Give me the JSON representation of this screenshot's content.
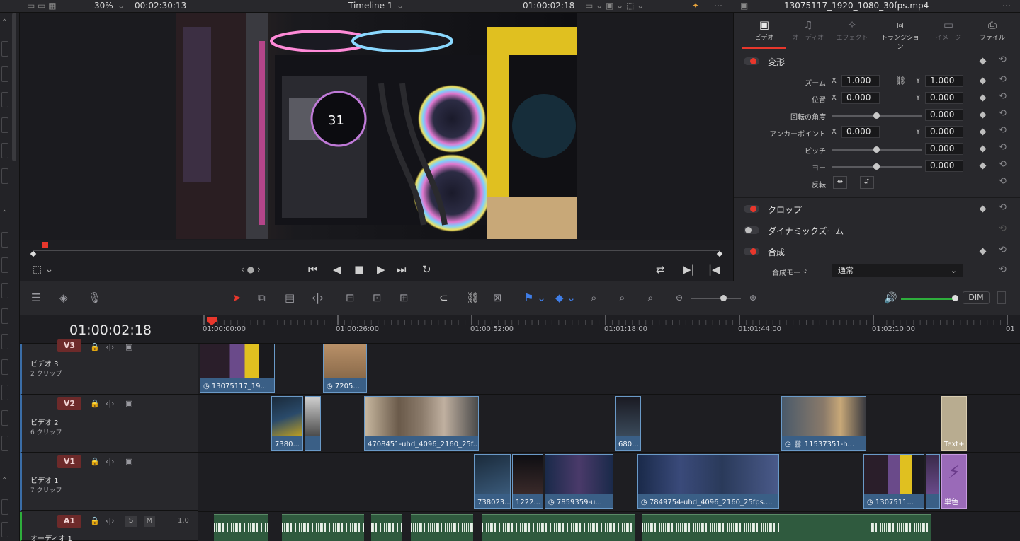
{
  "topbar": {
    "zoom": "30%",
    "source_timecode": "00:02:30:13",
    "timeline_name": "Timeline 1",
    "record_timecode": "01:00:02:18"
  },
  "inspector": {
    "clip_name": "13075117_1920_1080_30fps.mp4",
    "tabs": [
      "ビデオ",
      "オーディオ",
      "エフェクト",
      "トランジション",
      "イメージ",
      "ファイル"
    ],
    "active_tab": "ビデオ",
    "transform": {
      "title": "変形",
      "zoom_label": "ズーム",
      "zoom_x": "1.000",
      "zoom_y": "1.000",
      "position_label": "位置",
      "position_x": "0.000",
      "position_y": "0.000",
      "rotation_label": "回転の角度",
      "rotation": "0.000",
      "anchor_label": "アンカーポイント",
      "anchor_x": "0.000",
      "anchor_y": "0.000",
      "pitch_label": "ピッチ",
      "pitch": "0.000",
      "yaw_label": "ヨー",
      "yaw": "0.000",
      "flip_label": "反転",
      "x_axis": "X",
      "y_axis": "Y"
    },
    "crop_title": "クロップ",
    "dynamic_zoom_title": "ダイナミックズーム",
    "composite_title": "合成",
    "composite_mode_label": "合成モード",
    "composite_mode_value": "通常"
  },
  "toolbar": {
    "dim_label": "DIM"
  },
  "timeline": {
    "timecode": "01:00:02:18",
    "ruler": [
      "01:00:00:00",
      "01:00:26:00",
      "01:00:52:00",
      "01:01:18:00",
      "01:01:44:00",
      "01:02:10:00",
      "01"
    ],
    "tracks": {
      "v3": {
        "badge": "V3",
        "name": "ビデオ 3",
        "count": "2 クリップ"
      },
      "v2": {
        "badge": "V2",
        "name": "ビデオ 2",
        "count": "6 クリップ"
      },
      "v1": {
        "badge": "V1",
        "name": "ビデオ 1",
        "count": "7 クリップ"
      },
      "a1": {
        "badge": "A1",
        "name": "オーディオ 1",
        "level": "1.0",
        "solo": "S",
        "mute": "M"
      }
    },
    "clips": {
      "v3_1": "13075117_19...",
      "v3_2": "7205...",
      "v2_1": "7380...",
      "v2_2": "4708451-uhd_4096_2160_25f...",
      "v2_3": "680...",
      "v2_4": "11537351-h...",
      "v2_5": "Text+",
      "v1_1": "738023...",
      "v1_2": "1222...",
      "v1_3": "7859359-u...",
      "v1_4": "7849754-uhd_4096_2160_25fps....",
      "v1_5": "1307511...",
      "v1_6": "単色"
    }
  },
  "viewer": {
    "overlay_number": "31"
  }
}
